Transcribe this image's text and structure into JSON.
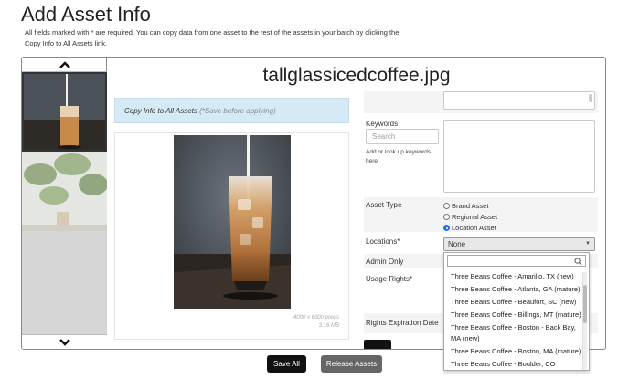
{
  "page": {
    "title": "Add Asset Info",
    "instructions": "All fields marked with * are required. You can copy data from one asset to the rest of the assets in your batch by clicking the Copy Info to All Assets link."
  },
  "asset": {
    "filename": "tallglassicedcoffee.jpg",
    "dimensions": "4000 x 6000 pixels",
    "filesize": "3.16 MB"
  },
  "copy_info": {
    "label": "Copy Info to All Assets",
    "note": "(*Save before applying)"
  },
  "form": {
    "keywords_label": "Keywords",
    "keywords_placeholder": "Search",
    "keywords_help": "Add or look up keywords here",
    "asset_type_label": "Asset Type",
    "asset_types": [
      "Brand Asset",
      "Regional Asset",
      "Location Asset"
    ],
    "asset_type_selected": "Location Asset",
    "locations_label": "Locations*",
    "locations_value": "None",
    "admin_only_label": "Admin Only",
    "usage_rights_label": "Usage Rights*",
    "rights_expiration_label": "Rights Expiration Date"
  },
  "dropdown": {
    "options": [
      "Three Beans Coffee - Amarillo, TX (new)",
      "Three Beans Coffee - Atlanta, GA (mature)",
      "Three Beans Coffee - Beaufort, SC (new)",
      "Three Beans Coffee - Billings, MT (mature)",
      "Three Beans Coffee - Boston - Back Bay, MA (new)",
      "Three Beans Coffee - Boston, MA (mature)",
      "Three Beans Coffee - Boulder, CO (mature)"
    ]
  },
  "buttons": {
    "save_all": "Save All",
    "release_assets": "Release Assets"
  },
  "icons": {
    "up": "chevron-up-icon",
    "down": "chevron-down-icon",
    "search": "search-icon",
    "caret": "caret-down-icon"
  },
  "colors": {
    "copy_box_bg": "#d6eaf5",
    "primary_button": "#111111",
    "secondary_button": "#666666",
    "radio_selected": "#1a73e8"
  }
}
